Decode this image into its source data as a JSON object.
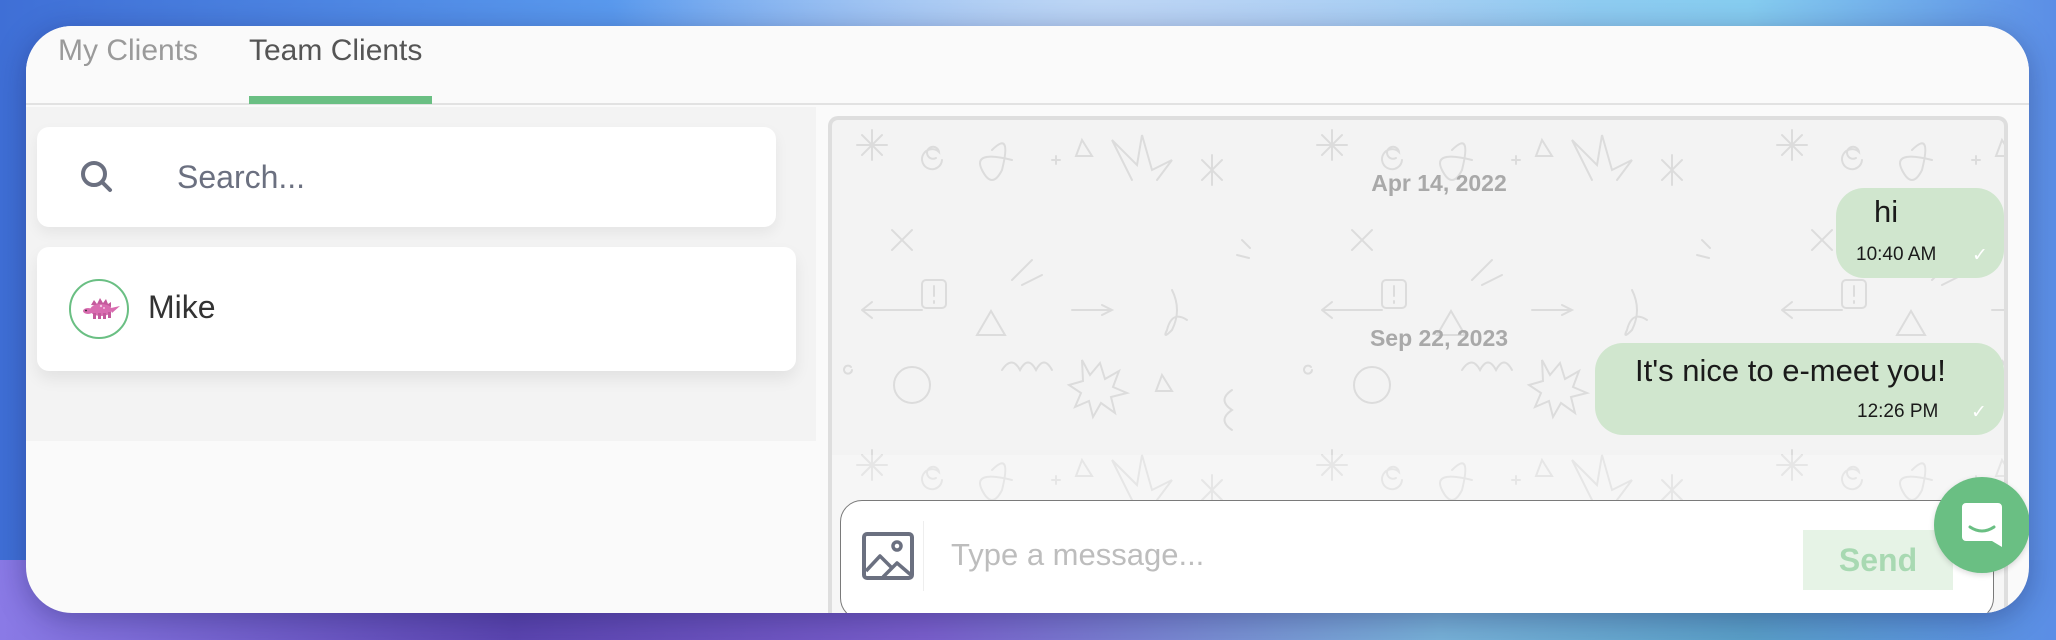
{
  "tabs": [
    {
      "label": "My Clients",
      "active": false
    },
    {
      "label": "Team Clients",
      "active": true
    }
  ],
  "colors": {
    "accent": "#6abf83",
    "bubble": "#d0e6ce",
    "send_bg": "#e6f3e6",
    "send_text": "#a8d9b2"
  },
  "search": {
    "placeholder": "Search...",
    "icon": "search-icon"
  },
  "clients": [
    {
      "name": "Mike",
      "avatar": "pink-stegosaurus-avatar"
    }
  ],
  "chat": {
    "date_separators": [
      "Apr 14, 2022",
      "Sep 22, 2023"
    ],
    "messages": [
      {
        "text": "hi",
        "time": "10:40 AM",
        "status": "sent-check"
      },
      {
        "text": "It's nice to e-meet you!",
        "time": "12:26 PM",
        "status": "sent-check"
      }
    ],
    "check_glyph": "✓"
  },
  "composer": {
    "placeholder": "Type a message...",
    "value": "",
    "attach_icon": "image-icon",
    "send_label": "Send"
  },
  "launcher": {
    "icon": "chat-bubble-smile-icon"
  }
}
